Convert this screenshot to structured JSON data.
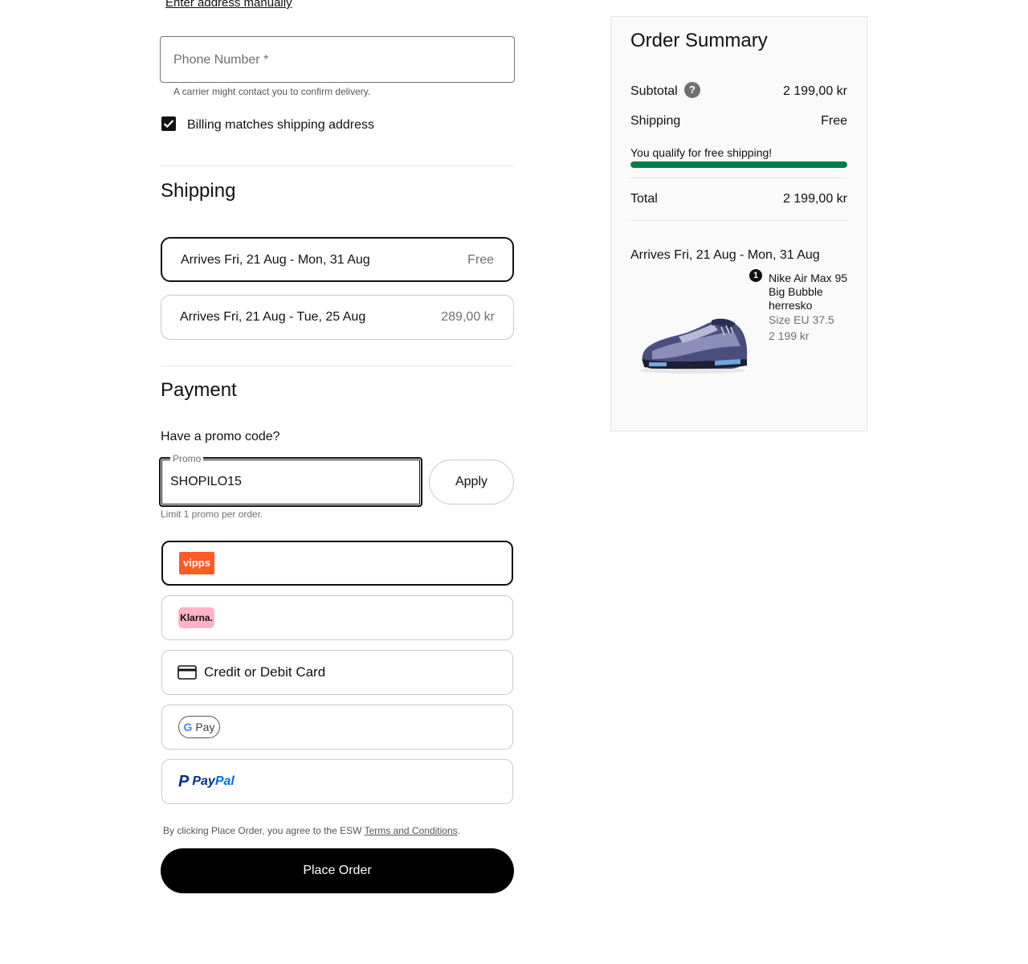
{
  "address": {
    "enter_manually_link": "Enter address manually"
  },
  "phone": {
    "placeholder": "Phone Number *",
    "helper": "A carrier might contact you to confirm delivery."
  },
  "billing": {
    "checked": true,
    "label": "Billing matches shipping address"
  },
  "shipping": {
    "title": "Shipping",
    "options": [
      {
        "label": "Arrives Fri, 21 Aug - Mon, 31 Aug",
        "price": "Free",
        "selected": true
      },
      {
        "label": "Arrives Fri, 21 Aug - Tue, 25 Aug",
        "price": "289,00 kr",
        "selected": false
      }
    ]
  },
  "payment": {
    "title": "Payment",
    "promo_question": "Have a promo code?",
    "promo_label": "Promo",
    "promo_value": "SHOPILO15",
    "apply_label": "Apply",
    "promo_limit": "Limit 1 promo per order.",
    "methods": [
      {
        "name": "Vipps",
        "logo_text": "vipps",
        "selected": true
      },
      {
        "name": "Klarna",
        "logo_text": "Klarna.",
        "selected": false
      },
      {
        "name": "Card",
        "label": "Credit or Debit Card",
        "selected": false
      },
      {
        "name": "Google Pay",
        "logo_text": "Pay",
        "selected": false
      },
      {
        "name": "PayPal",
        "logo_text_1": "Pay",
        "logo_text_2": "Pal",
        "selected": false
      }
    ],
    "terms_prefix": "By clicking Place Order, you agree to the ESW ",
    "terms_link": "Terms and Conditions",
    "terms_suffix": ".",
    "place_order": "Place Order"
  },
  "summary": {
    "title": "Order Summary",
    "subtotal_label": "Subtotal",
    "subtotal_value": "2 199,00 kr",
    "help_icon": "?",
    "shipping_label": "Shipping",
    "shipping_value": "Free",
    "free_shipping_msg": "You qualify for free shipping!",
    "free_shipping_progress": 1.0,
    "total_label": "Total",
    "total_value": "2 199,00 kr",
    "arrives": "Arrives Fri, 21 Aug - Mon, 31 Aug",
    "item": {
      "quantity": "1",
      "name": "Nike Air Max 95 Big Bubble herresko",
      "size": "Size EU 37.5",
      "price": "2 199 kr"
    }
  },
  "colors": {
    "progress": "#007d48",
    "vipps": "#ff5b24",
    "klarna": "#ffb3c7",
    "paypal_dark": "#003087",
    "paypal_light": "#0070e0"
  }
}
